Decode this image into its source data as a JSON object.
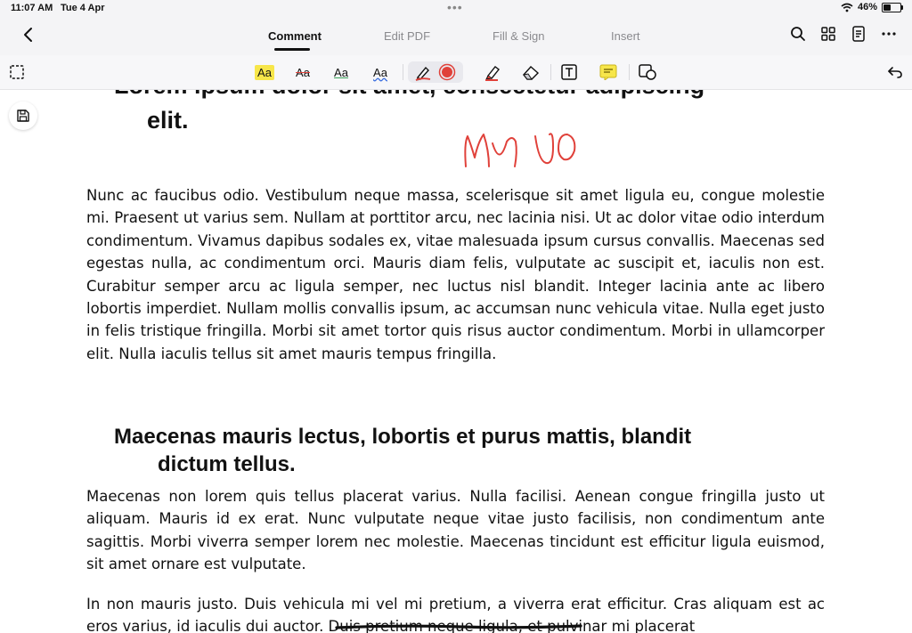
{
  "status_bar": {
    "time": "11:07 AM",
    "date": "Tue 4 Apr",
    "battery": "46%",
    "dots": "•••"
  },
  "nav": {
    "tabs": [
      "Comment",
      "Edit PDF",
      "Fill & Sign",
      "Insert"
    ],
    "active_tab": "Comment"
  },
  "toolbar": {
    "text_style_label": "Aa"
  },
  "document": {
    "heading1_line1": "Lorem ipsum dolor sit amet, consectetur adipiscing",
    "heading1_line2": "elit.",
    "para1": "Nunc ac faucibus odio. Vestibulum neque massa, scelerisque sit amet ligula eu, congue molestie mi. Praesent ut varius sem. Nullam at porttitor arcu, nec lacinia nisi. Ut ac dolor vitae odio interdum condimentum. Vivamus dapibus sodales ex, vitae malesuada ipsum cursus convallis. Maecenas sed egestas nulla, ac condimentum orci. Mauris diam felis, vulputate ac suscipit et, iaculis non est. Curabitur semper arcu ac ligula semper, nec luctus nisl blandit. Integer lacinia ante ac libero lobortis imperdiet. Nullam mollis convallis ipsum, ac accumsan nunc vehicula vitae. Nulla eget justo in felis tristique fringilla. Morbi sit amet tortor quis risus auctor condimentum. Morbi in ullamcorper elit. Nulla iaculis tellus sit amet mauris tempus fringilla.",
    "heading2_line1": "Maecenas mauris lectus, lobortis et purus mattis, blandit",
    "heading2_line2": "dictum tellus.",
    "para2": "Maecenas non lorem quis tellus placerat varius. Nulla facilisi. Aenean congue fringilla justo ut aliquam. Mauris id ex erat. Nunc vulputate neque vitae justo facilisis, non condimentum ante sagittis. Morbi viverra semper lorem nec molestie. Maecenas tincidunt est efficitur ligula euismod, sit amet ornare est vulputate.",
    "para3": "In non mauris justo. Duis vehicula mi vel mi pretium, a viverra erat efficitur. Cras aliquam est ac eros varius, id iaculis dui auctor. Duis pretium neque ligula, et pulvinar mi placerat"
  },
  "colors": {
    "ink_red": "#e0413a",
    "highlight": "#f7e64a",
    "bar_bg": "#f4f4f6"
  }
}
